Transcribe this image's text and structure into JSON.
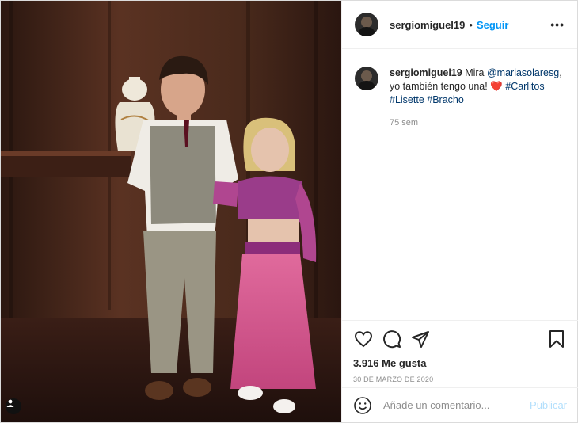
{
  "post": {
    "username": "sergiomiguel19",
    "follow_label": "Seguir",
    "more_label": "•••",
    "caption": {
      "username": "sergiomiguel19",
      "text_1": "Mira",
      "mention": "@mariasolaresg",
      "text_2": ", yo también tengo una!",
      "emoji": "❤️",
      "hashtag_1": "#Carlitos",
      "hashtag_2": "#Lisette",
      "hashtag_3": "#Bracho",
      "time": "75 sem"
    },
    "likes": "3.916 Me gusta",
    "date": "30 DE MARZO DE 2020",
    "comment": {
      "placeholder": "Añade un comentario...",
      "publish_label": "Publicar"
    },
    "colors": {
      "accent": "#0095f6",
      "publish_disabled": "#b2dffc",
      "mention": "#00376b"
    }
  }
}
